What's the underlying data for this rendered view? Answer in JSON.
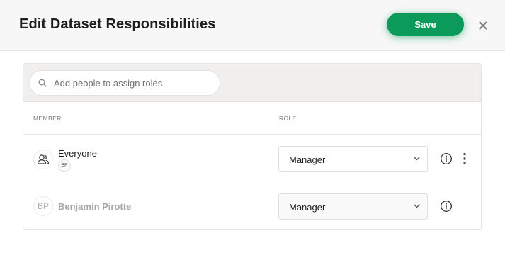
{
  "header": {
    "title": "Edit Dataset Responsibilities",
    "save_label": "Save",
    "close_icon": "close-icon"
  },
  "search": {
    "placeholder": "Add people to assign roles",
    "value": "",
    "icon": "search-icon"
  },
  "columns": {
    "member": "MEMBER",
    "role": "ROLE"
  },
  "rows": [
    {
      "name": "Everyone",
      "avatar_icon": "group-icon",
      "badge": "BP",
      "role": "Manager",
      "has_more_menu": true
    },
    {
      "name": "Benjamin Pirotte",
      "avatar_initials": "BP",
      "role": "Manager",
      "has_more_menu": false
    }
  ],
  "colors": {
    "accent": "#0c9a5a",
    "header_bg": "#f7f7f7",
    "search_bar_bg": "#f0efed"
  }
}
